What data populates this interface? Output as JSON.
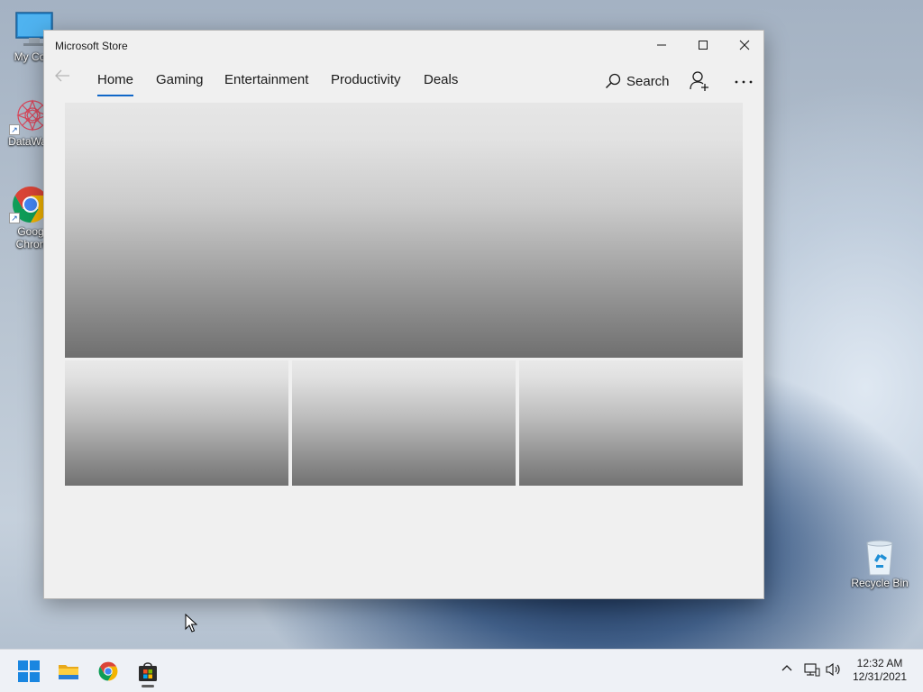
{
  "desktop": {
    "icons": [
      {
        "label": "My Com",
        "icon": "monitor-icon"
      },
      {
        "label": "DataWag",
        "icon": "datawagon-icon"
      },
      {
        "label_line1": "Goog",
        "label_line2": "Chron",
        "icon": "chrome-icon"
      },
      {
        "label": "Recycle Bin",
        "icon": "recycle-bin-icon"
      }
    ]
  },
  "window": {
    "title": "Microsoft Store",
    "controls": {
      "minimize": "minimize-icon",
      "maximize": "maximize-icon",
      "close": "close-icon"
    }
  },
  "nav": {
    "back_icon": "back-arrow-icon",
    "tabs": [
      {
        "label": "Home",
        "active": true
      },
      {
        "label": "Gaming",
        "active": false
      },
      {
        "label": "Entertainment",
        "active": false
      },
      {
        "label": "Productivity",
        "active": false
      },
      {
        "label": "Deals",
        "active": false
      }
    ],
    "search_label": "Search",
    "account_icon": "add-account-icon",
    "more_icon": "more-dots-icon",
    "accent_color": "#1067c8"
  },
  "taskbar": {
    "apps": [
      "windows-start-icon",
      "file-explorer-icon",
      "chrome-icon",
      "microsoft-store-icon"
    ],
    "tray": [
      "chevron-up-icon",
      "network-icon",
      "volume-icon"
    ],
    "time": "12:32 AM",
    "date": "12/31/2021"
  }
}
